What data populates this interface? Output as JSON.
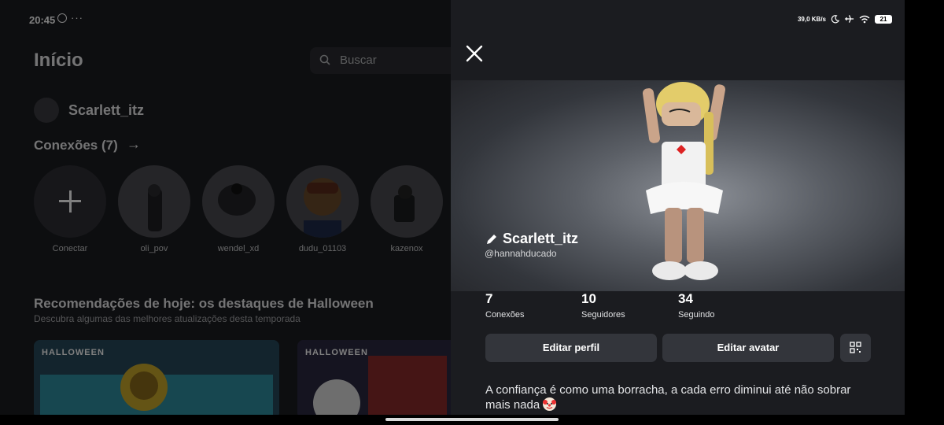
{
  "status_bar": {
    "time": "20:45",
    "more": "···",
    "net_speed": "39,0 KB/s",
    "battery": "21"
  },
  "home": {
    "title": "Início",
    "search_placeholder": "Buscar",
    "username": "Scarlett_itz",
    "connections_title": "Conexões (7)",
    "connections_arrow": "→",
    "friends": [
      {
        "name": "Conectar"
      },
      {
        "name": "oli_pov"
      },
      {
        "name": "wendel_xd"
      },
      {
        "name": "dudu_01103"
      },
      {
        "name": "kazenox"
      }
    ],
    "recommendations_title": "Recomendações de hoje: os destaques de Halloween",
    "recommendations_subtitle": "Descubra algumas das melhores atualizações desta temporada",
    "cards": [
      {
        "label": "HALLOWEEN"
      },
      {
        "label": "HALLOWEEN"
      }
    ]
  },
  "profile": {
    "display_name": "Scarlett_itz",
    "handle": "@hannahducado",
    "stats": [
      {
        "value": "7",
        "label": "Conexões"
      },
      {
        "value": "10",
        "label": "Seguidores"
      },
      {
        "value": "34",
        "label": "Seguindo"
      }
    ],
    "edit_profile_label": "Editar perfil",
    "edit_avatar_label": "Editar avatar",
    "bio": "A confiança é como uma borracha, a cada erro diminui até não sobrar mais nada"
  },
  "colors": {
    "panel_bg": "#1b1c20",
    "button_bg": "#33353b"
  }
}
